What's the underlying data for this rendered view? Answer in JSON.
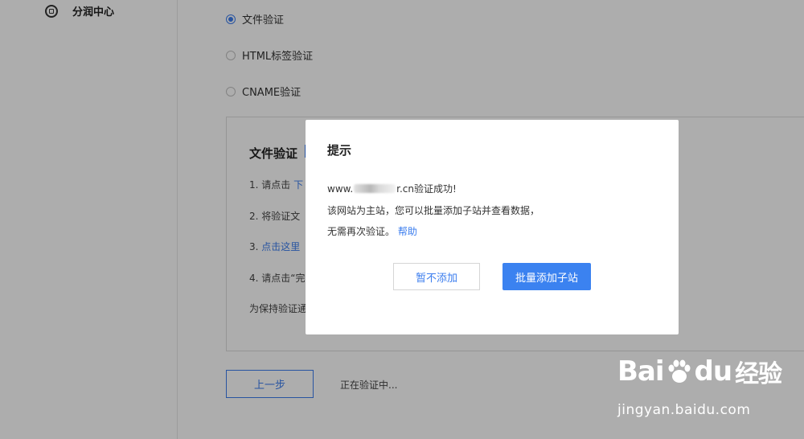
{
  "sidebar": {
    "items": [
      {
        "icon": "revenue-center-icon",
        "label": "分润中心"
      }
    ]
  },
  "verification_methods": {
    "options": [
      {
        "label": "文件验证",
        "checked": true
      },
      {
        "label": "HTML标签验证",
        "checked": false
      },
      {
        "label": "CNAME验证",
        "checked": false
      }
    ]
  },
  "file_verification_panel": {
    "title": "文件验证",
    "steps": [
      {
        "number": "1.",
        "text": "请点击",
        "link": "下"
      },
      {
        "number": "2.",
        "text": "将验证文"
      },
      {
        "number": "3.",
        "link": "点击这里"
      },
      {
        "number": "4.",
        "text": "请点击“完"
      }
    ],
    "note": "为保持验证通"
  },
  "footer": {
    "prev_button_label": "上一步",
    "status_text": "正在验证中..."
  },
  "modal": {
    "title": "提示",
    "line1_prefix": "www.",
    "line1_suffix": "r.cn验证成功!",
    "line2": "该网站为主站，您可以批量添加子站并查看数据，",
    "line3": "无需再次验证。",
    "help_link": "帮助",
    "cancel_button": "暂不添加",
    "confirm_button": "批量添加子站",
    "accent_color": "#3b82f0"
  },
  "watermark": {
    "brand_left": "Bai",
    "brand_right": "du",
    "brand_cn": "经验",
    "url": "jingyan.baidu.com"
  }
}
